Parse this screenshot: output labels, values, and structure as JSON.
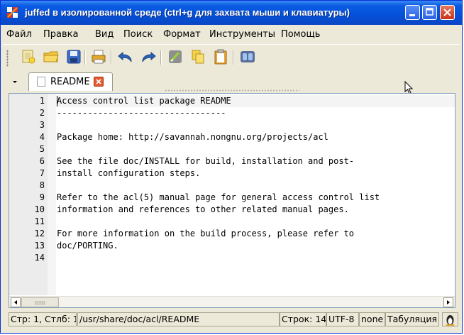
{
  "window": {
    "title": "juffed в изолированной среде (ctrl+g для захвата мыши и клавиатуры)"
  },
  "menu": {
    "items": [
      "Файл",
      "Правка",
      "Вид",
      "Поиск",
      "Формат",
      "Инструменты",
      "Помощь"
    ]
  },
  "toolbar": {
    "buttons": [
      "new-file-icon",
      "open-folder-icon",
      "save-icon",
      "print-icon",
      "undo-icon",
      "redo-icon",
      "cut-icon",
      "copy-icon",
      "paste-icon",
      "find-icon"
    ]
  },
  "tabs": [
    {
      "label": "README",
      "active": true
    }
  ],
  "editor": {
    "line_numbers": [
      "1",
      "2",
      "3",
      "4",
      "5",
      "6",
      "7",
      "8",
      "9",
      "10",
      "11",
      "12",
      "13",
      "14"
    ],
    "lines": [
      "Access control list package README",
      "---------------------------------",
      "",
      "Package home: http://savannah.nongnu.org/projects/acl",
      "",
      "See the file doc/INSTALL for build, installation and post-",
      "install configuration steps.",
      "",
      "Refer to the acl(5) manual page for general access control list",
      "information and references to other related manual pages.",
      "",
      "For more information on the build process, please refer to",
      "doc/PORTING.",
      ""
    ],
    "current_line": 1
  },
  "status": {
    "position": "Стр: 1, Стлб: 1",
    "path": "/usr/share/doc/acl/README",
    "line_count": "Строк: 14",
    "encoding": "UTF-8",
    "eol": "none",
    "indent": "Табуляция"
  },
  "colors": {
    "titlebar": "#0a5ce2",
    "chrome": "#ece9d8",
    "close_tab": "#e6582e"
  }
}
